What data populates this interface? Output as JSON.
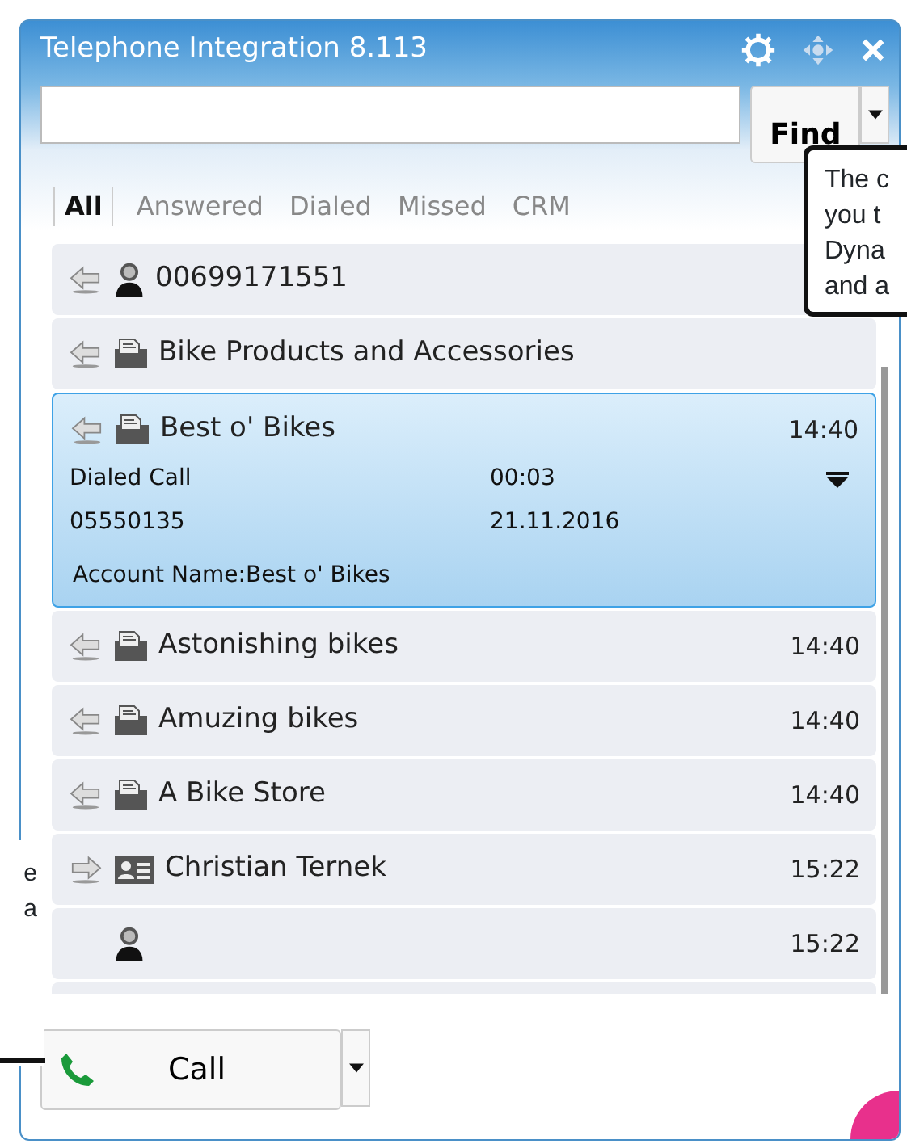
{
  "window": {
    "title": "Telephone Integration 8.113"
  },
  "search": {
    "button": "Find"
  },
  "tabs": [
    {
      "label": "All",
      "selected": true
    },
    {
      "label": "Answered",
      "selected": false
    },
    {
      "label": "Dialed",
      "selected": false
    },
    {
      "label": "Missed",
      "selected": false
    },
    {
      "label": "CRM",
      "selected": false
    }
  ],
  "calls": [
    {
      "outgoing": false,
      "kind": "person",
      "name": "00699171551",
      "selected": false
    },
    {
      "outgoing": false,
      "kind": "account",
      "name": "Bike Products and Accessories",
      "selected": false
    },
    {
      "outgoing": false,
      "kind": "account",
      "name": "Best o' Bikes",
      "time": "14:40",
      "selected": true,
      "details": {
        "call_type": "Dialed Call",
        "duration": "00:03",
        "number": "05550135",
        "date": "21.11.2016",
        "info": "Account Name:Best o' Bikes"
      }
    },
    {
      "outgoing": false,
      "kind": "account",
      "name": "Astonishing bikes",
      "time": "14:40",
      "selected": false
    },
    {
      "outgoing": false,
      "kind": "account",
      "name": "Amuzing bikes",
      "time": "14:40",
      "selected": false
    },
    {
      "outgoing": false,
      "kind": "account",
      "name": "A Bike Store",
      "time": "14:40",
      "selected": false
    },
    {
      "outgoing": true,
      "kind": "contact",
      "name": "Christian Ternek",
      "time": "15:22",
      "selected": false
    },
    {
      "kind": "person",
      "time": "15:22",
      "selected": false
    }
  ],
  "call_button": {
    "label": "Call"
  },
  "callouts": [
    {
      "lines": [
        "The c",
        "you t",
        "Dyna",
        "and a"
      ]
    },
    {
      "lines": [
        "e",
        "a"
      ]
    }
  ]
}
